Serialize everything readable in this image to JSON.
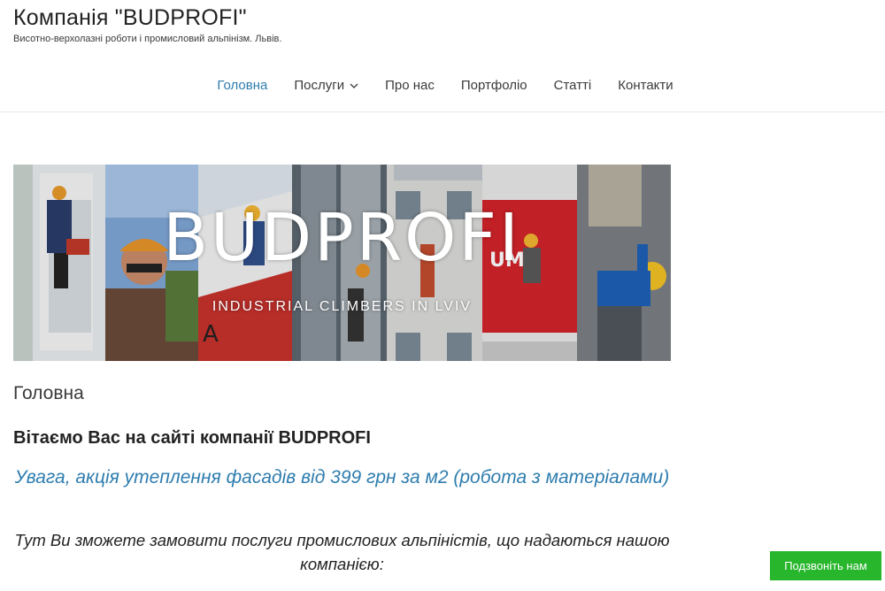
{
  "site": {
    "title": "Компанія \"BUDPROFI\"",
    "description": "Висотно-верхолазні роботи і промисловий альпінізм. Львів."
  },
  "nav": {
    "items": [
      {
        "label": "Головна",
        "active": true
      },
      {
        "label": "Послуги",
        "has_dropdown": true
      },
      {
        "label": "Про нас"
      },
      {
        "label": "Портфоліо"
      },
      {
        "label": "Статті"
      },
      {
        "label": "Контакти"
      }
    ]
  },
  "hero": {
    "title": "BUDPROFI",
    "subtitle": "INDUSTRIAL CLIMBERS IN LVIV"
  },
  "content": {
    "page_title": "Головна",
    "welcome": "Вітаємо Вас на сайті компанії BUDPROFI",
    "promo": "Увага, акція утеплення фасадів від 399 грн за м2 (робота з матеріалами)",
    "intro": "Тут Ви зможете замовити послуги промислових альпіністів, що надаються нашою компанією:"
  },
  "call_button": {
    "label": "Подзвоніть нам"
  },
  "colors": {
    "accent": "#2f7daf",
    "call_button": "#28b62c"
  }
}
